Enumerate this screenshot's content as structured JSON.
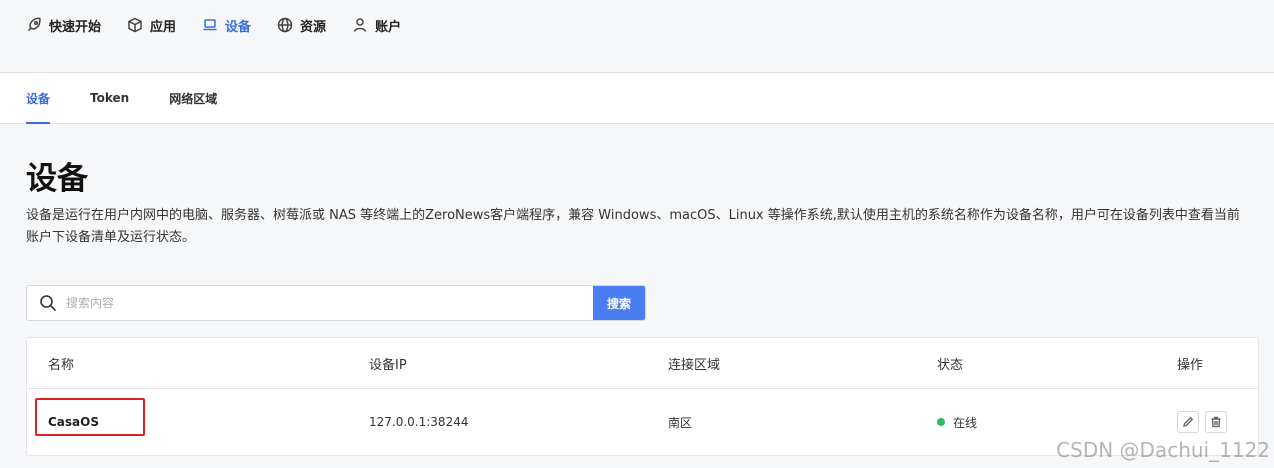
{
  "topnav": {
    "items": [
      {
        "label": "快速开始",
        "icon": "rocket-icon"
      },
      {
        "label": "应用",
        "icon": "cube-icon"
      },
      {
        "label": "设备",
        "icon": "laptop-icon",
        "active": true
      },
      {
        "label": "资源",
        "icon": "globe-icon"
      },
      {
        "label": "账户",
        "icon": "user-icon"
      }
    ]
  },
  "subtabs": [
    {
      "label": "设备",
      "active": true
    },
    {
      "label": "Token"
    },
    {
      "label": "网络区域"
    }
  ],
  "page": {
    "title": "设备",
    "description": "设备是运行在用户内网中的电脑、服务器、树莓派或 NAS 等终端上的ZeroNews客户端程序，兼容 Windows、macOS、Linux 等操作系统,默认使用主机的系统名称作为设备名称，用户可在设备列表中查看当前账户下设备清单及运行状态。"
  },
  "search": {
    "placeholder": "搜索内容",
    "value": "",
    "button_label": "搜索"
  },
  "table": {
    "columns": [
      "名称",
      "设备IP",
      "连接区域",
      "状态",
      "操作"
    ],
    "rows": [
      {
        "name": "CasaOS",
        "ip": "127.0.0.1:38244",
        "region": "南区",
        "status": "在线"
      }
    ]
  },
  "colors": {
    "accent": "#3b6fd8",
    "search_button": "#4a7ef0",
    "status_online": "#2fb86a",
    "highlight": "#e02020"
  },
  "watermark": "CSDN @Dachui_1122"
}
